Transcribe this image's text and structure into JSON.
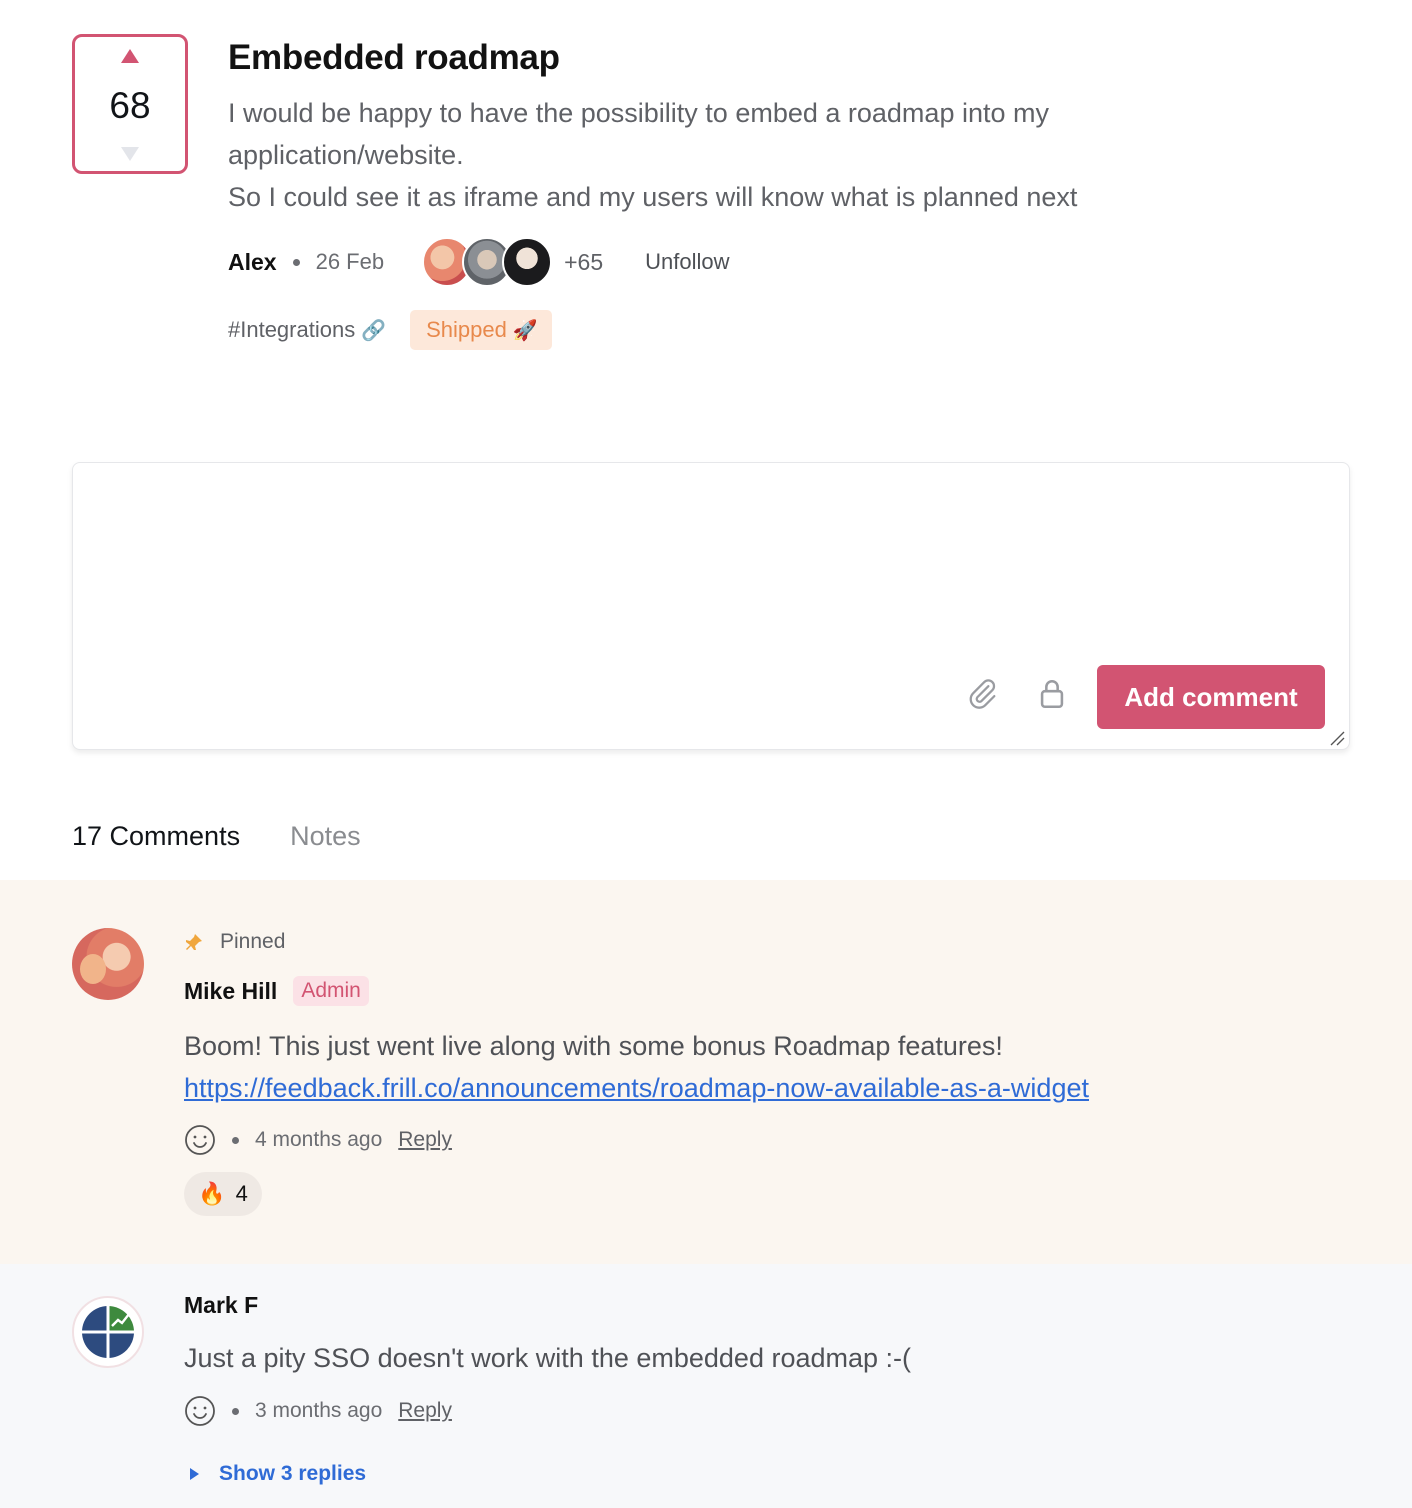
{
  "idea": {
    "votes": "68",
    "title": "Embedded roadmap",
    "description_lines": [
      "I would be happy to have the possibility to embed a roadmap into my",
      "application/website.",
      "So I could see it as iframe and my users will know what is planned next"
    ],
    "author": "Alex",
    "date": "26 Feb",
    "followers_extra": "+65",
    "follow_action": "Unfollow",
    "topic": "#Integrations",
    "topic_icon": "link-icon",
    "status": "Shipped",
    "status_icon": "rocket-icon",
    "colors": {
      "accent": "#d25472",
      "status_bg": "#fde8da",
      "status_text": "#e8894c",
      "link": "#2f6bd6"
    }
  },
  "comment_form": {
    "placeholder": "",
    "attach_icon": "paperclip-icon",
    "private_icon": "lock-icon",
    "submit_label": "Add comment"
  },
  "tabs": {
    "comments": "17 Comments",
    "notes": "Notes",
    "active": "comments"
  },
  "comments": [
    {
      "pinned": true,
      "pinned_label": "Pinned",
      "author": "Mike Hill",
      "badge": "Admin",
      "text": "Boom! This just went live along with some bonus Roadmap features!",
      "link": "https://feedback.frill.co/announcements/roadmap-now-available-as-a-widget",
      "time": "4 months ago",
      "reply_label": "Reply",
      "reactions": [
        {
          "emoji": "🔥",
          "count": "4"
        }
      ],
      "background": "#fbf6f0"
    },
    {
      "pinned": false,
      "author": "Mark F",
      "text": "Just a pity SSO doesn't work with the embedded roadmap :-(",
      "time": "3 months ago",
      "reply_label": "Reply",
      "show_replies_label": "Show 3 replies",
      "background": "#f7f8fa"
    }
  ]
}
